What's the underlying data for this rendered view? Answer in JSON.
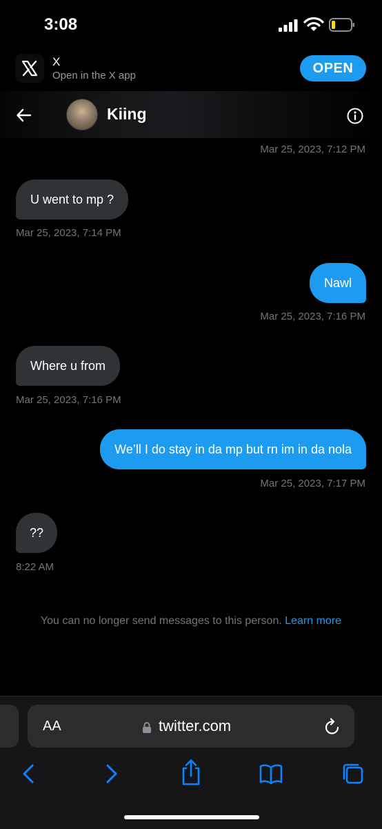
{
  "status_bar": {
    "time": "3:08",
    "battery_level": 0.2,
    "battery_color": "#ffd60a"
  },
  "banner": {
    "title": "X",
    "subtitle": "Open in the X app",
    "open_label": "OPEN"
  },
  "chat": {
    "contact_name": "Kiing"
  },
  "messages": {
    "top_ts": "Mar 25, 2023, 7:12 PM",
    "m1": {
      "text": "U went to mp ?",
      "ts": "Mar 25, 2023, 7:14 PM",
      "dir": "in"
    },
    "m2": {
      "text": "Nawl",
      "ts": "Mar 25, 2023, 7:16 PM",
      "dir": "out"
    },
    "m3": {
      "text": "Where u from",
      "ts": "Mar 25, 2023, 7:16 PM",
      "dir": "in"
    },
    "m4": {
      "text": "We’ll I do stay in da mp but rn im in da nola",
      "ts": "Mar 25, 2023, 7:17 PM",
      "dir": "out"
    },
    "m5": {
      "text": "??",
      "ts": "8:22 AM",
      "dir": "in"
    }
  },
  "notice": {
    "text": "You can no longer send messages to this person.",
    "link": "Learn more"
  },
  "safari": {
    "aa_label": "AA",
    "url": "twitter.com"
  },
  "colors": {
    "accent": "#1d9bf0",
    "incoming_bubble": "#2f3336",
    "meta_text": "#71767b",
    "safari_icon": "#0a84ff"
  },
  "icons": [
    "x-logo-icon",
    "back-arrow-icon",
    "info-icon",
    "lock-icon",
    "reload-icon",
    "back-chevron-icon",
    "forward-chevron-icon",
    "share-icon",
    "bookmarks-icon",
    "tabs-icon"
  ]
}
